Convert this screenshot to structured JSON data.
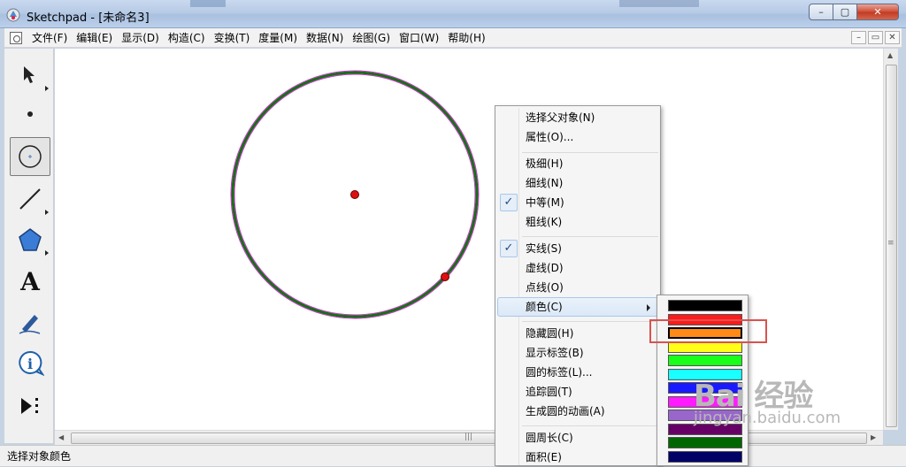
{
  "window": {
    "title": "Sketchpad - [未命名3]",
    "controls": {
      "minimize": "–",
      "maximize": "▢",
      "close": "✕"
    }
  },
  "menubar": {
    "items": [
      "文件(F)",
      "编辑(E)",
      "显示(D)",
      "构造(C)",
      "变换(T)",
      "度量(M)",
      "数据(N)",
      "绘图(G)",
      "窗口(W)",
      "帮助(H)"
    ],
    "mdi_controls": {
      "minimize": "–",
      "restore": "▭",
      "close": "✕"
    }
  },
  "toolbox": {
    "tools": [
      {
        "name": "arrow-tool",
        "icon": "arrow-icon",
        "active": false
      },
      {
        "name": "point-tool",
        "icon": "point-icon",
        "active": false
      },
      {
        "name": "compass-tool",
        "icon": "circle-icon",
        "active": true
      },
      {
        "name": "straightedge-tool",
        "icon": "line-icon",
        "active": false
      },
      {
        "name": "polygon-tool",
        "icon": "pentagon-icon",
        "active": false
      },
      {
        "name": "text-tool",
        "icon": "text-icon",
        "label": "A",
        "active": false
      },
      {
        "name": "marker-tool",
        "icon": "pen-icon",
        "active": false
      },
      {
        "name": "info-tool",
        "icon": "info-icon",
        "label": "i",
        "active": false
      },
      {
        "name": "custom-tool",
        "icon": "play-more-icon",
        "active": false
      }
    ]
  },
  "context_menu": {
    "items": [
      {
        "label": "选择父对象(N)"
      },
      {
        "label": "属性(O)..."
      },
      {
        "label": "极细(H)"
      },
      {
        "label": "细线(N)"
      },
      {
        "label": "中等(M)",
        "checked": true
      },
      {
        "label": "粗线(K)"
      },
      {
        "label": "实线(S)",
        "checked": true
      },
      {
        "label": "虚线(D)"
      },
      {
        "label": "点线(O)"
      },
      {
        "label": "颜色(C)",
        "submenu": true,
        "highlighted": true
      },
      {
        "label": "隐藏圆(H)"
      },
      {
        "label": "显示标签(B)"
      },
      {
        "label": "圆的标签(L)..."
      },
      {
        "label": "追踪圆(T)"
      },
      {
        "label": "生成圆的动画(A)"
      },
      {
        "label": "圆周长(C)"
      },
      {
        "label": "面积(E)"
      }
    ],
    "check_glyph": "✓"
  },
  "color_palette": {
    "swatches": [
      "#000000",
      "#ff1a1a",
      "#ff8a1a",
      "#ffff1a",
      "#1aff1a",
      "#1affff",
      "#1a1aff",
      "#ff1aff",
      "#9966cc",
      "#660066",
      "#006600",
      "#000066"
    ],
    "selected_index": 2
  },
  "colors": {
    "circle_stroke": "#1a6b1a",
    "selection_halo": "#cc33cc",
    "point": "#d11",
    "highlight_box": "#d9534f"
  },
  "statusbar": {
    "text": "选择对象颜色"
  },
  "scroll": {
    "v_grip": "≡",
    "h_grip": "|||"
  },
  "watermark": {
    "logo": "Bai 经验",
    "url": "jingyan.baidu.com"
  }
}
